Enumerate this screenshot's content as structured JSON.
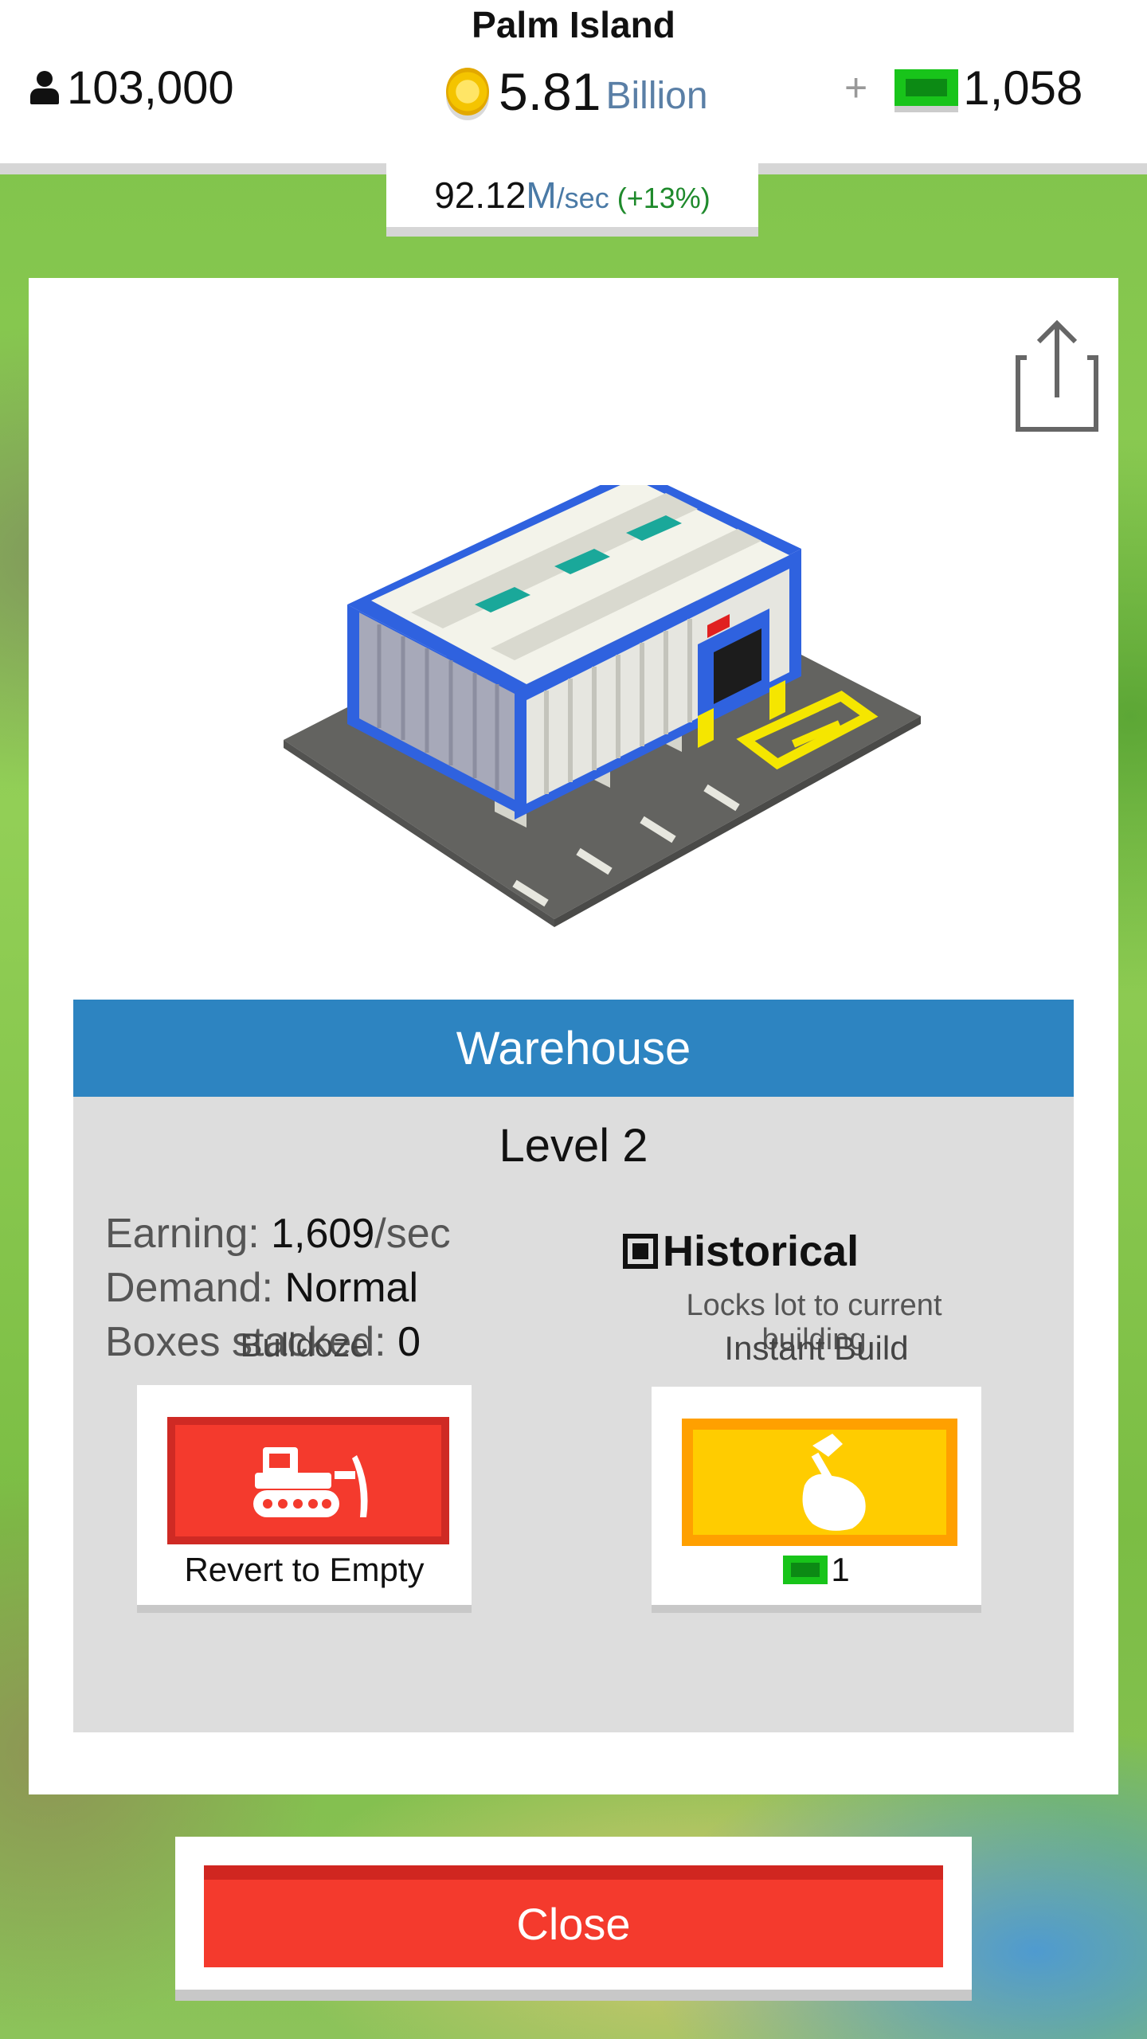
{
  "header": {
    "island_name": "Palm Island",
    "population": "103,000",
    "money_value": "5.81",
    "money_unit": "Billion",
    "gems": "1,058",
    "plus_symbol": "+",
    "rate_value": "92.12",
    "rate_unit": "M",
    "rate_per": "/sec",
    "rate_bonus": "(+13%)"
  },
  "building": {
    "name": "Warehouse",
    "level": "Level 2",
    "earning_label": "Earning:",
    "earning_value": "1,609",
    "earning_unit": "/sec",
    "demand_label": "Demand:",
    "demand_value": "Normal",
    "boxes_label": "Boxes stacked:",
    "boxes_value": "0",
    "historical_label": "Historical",
    "historical_checked": true,
    "historical_desc": "Locks lot to current building"
  },
  "actions": {
    "bulldoze_title": "Bulldoze",
    "bulldoze_label": "Revert to Empty",
    "instant_title": "Instant Build",
    "instant_cost": "1"
  },
  "footer": {
    "close_label": "Close"
  },
  "colors": {
    "header_blue": "#2d84c1",
    "bulldoze_red": "#f43a2d",
    "instant_yellow": "#ffcc00",
    "gem_green": "#18c41a",
    "coin_gold": "#f4c400"
  },
  "icons": [
    "population-icon",
    "coin-icon",
    "plus-icon",
    "gem-icon",
    "share-icon",
    "checkbox-icon",
    "bulldozer-icon",
    "hammer-hand-icon"
  ]
}
